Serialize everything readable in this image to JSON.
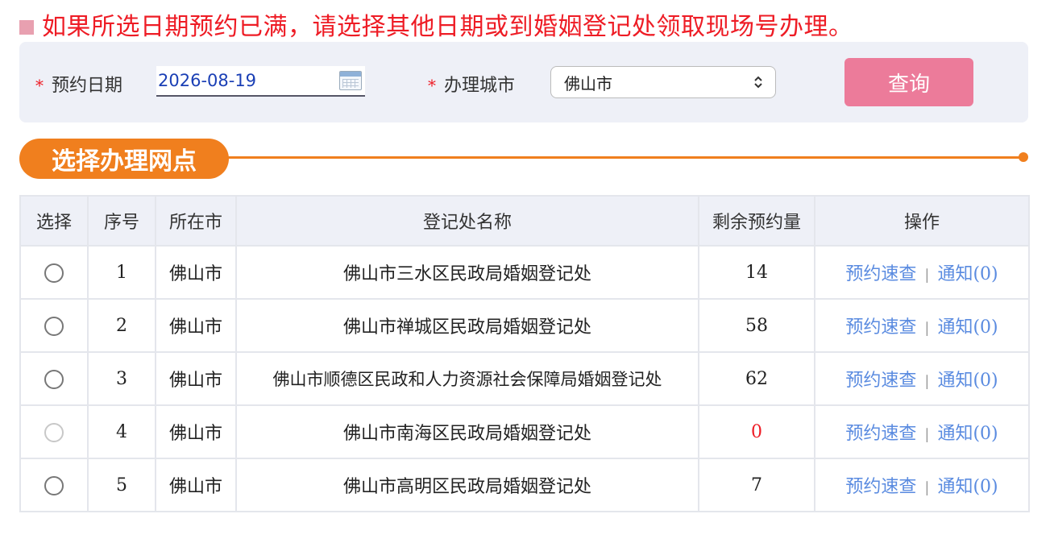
{
  "notice": "如果所选日期预约已满，请选择其他日期或到婚姻登记处领取现场号办理。",
  "search": {
    "required_mark": "*",
    "date_label": "预约日期",
    "date_value": "2026-08-19",
    "city_label": "办理城市",
    "city_value": "佛山市",
    "query_button": "查询"
  },
  "section_title": "选择办理网点",
  "table": {
    "headers": [
      "选择",
      "序号",
      "所在市",
      "登记处名称",
      "剩余预约量",
      "操作"
    ],
    "rows": [
      {
        "index": "1",
        "city": "佛山市",
        "name": "佛山市三水区民政局婚姻登记处",
        "remaining": "14",
        "action1": "预约速查",
        "sep": "|",
        "action2": "通知(0)"
      },
      {
        "index": "2",
        "city": "佛山市",
        "name": "佛山市禅城区民政局婚姻登记处",
        "remaining": "58",
        "action1": "预约速查",
        "sep": "|",
        "action2": "通知(0)"
      },
      {
        "index": "3",
        "city": "佛山市",
        "name": "佛山市顺德区民政和人力资源社会保障局婚姻登记处",
        "remaining": "62",
        "action1": "预约速查",
        "sep": "|",
        "action2": "通知(0)"
      },
      {
        "index": "4",
        "city": "佛山市",
        "name": "佛山市南海区民政局婚姻登记处",
        "remaining": "0",
        "action1": "预约速查",
        "sep": "|",
        "action2": "通知(0)"
      },
      {
        "index": "5",
        "city": "佛山市",
        "name": "佛山市高明区民政局婚姻登记处",
        "remaining": "7",
        "action1": "预约速查",
        "sep": "|",
        "action2": "通知(0)"
      }
    ]
  },
  "colors": {
    "notice_text": "#ee1c25",
    "query_button": "#ec7b9a",
    "section_accent": "#f07f1e",
    "remaining_available": "#3a8a2a",
    "remaining_zero": "#ee1c25",
    "link": "#5a8be0"
  },
  "icons": [
    "calendar-icon",
    "select-updown-icon",
    "radio-icon"
  ]
}
